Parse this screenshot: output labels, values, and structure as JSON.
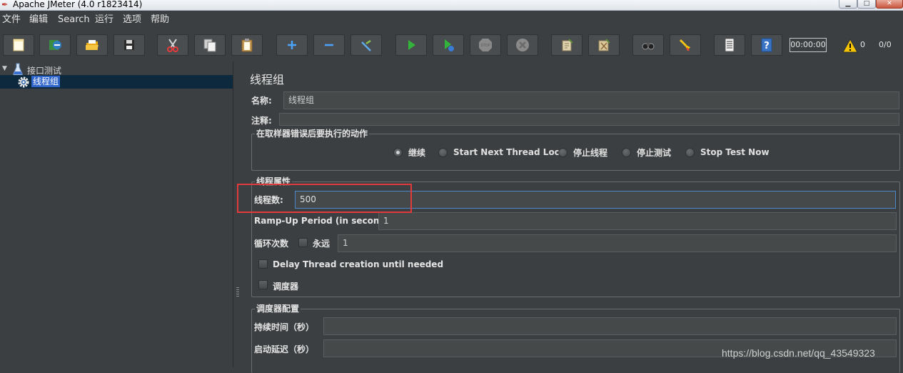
{
  "window": {
    "title": "Apache JMeter (4.0 r1823414)"
  },
  "menu": [
    "文件",
    "编辑",
    "Search",
    "运行",
    "选项",
    "帮助"
  ],
  "toolbar": {
    "buttons": [
      "new-icon",
      "templates-icon",
      "open-icon",
      "save-icon",
      "cut-icon",
      "copy-icon",
      "paste-icon",
      "expand-icon",
      "collapse-icon",
      "toggle-icon",
      "start-icon",
      "start-no-pause-icon",
      "stop-icon",
      "shutdown-icon",
      "clear-icon",
      "clear-all-icon",
      "search-icon",
      "reset-search-icon",
      "function-helper-icon",
      "help-icon"
    ],
    "timer": "00:00:00",
    "warnings": "0",
    "threads": "0/0"
  },
  "tree": {
    "root": "接口测试",
    "child": "线程组"
  },
  "panel": {
    "title": "线程组",
    "name_label": "名称:",
    "name_value": "线程组",
    "comment_label": "注释:",
    "comment_value": "",
    "error_group": "在取样器错误后要执行的动作",
    "error_options": [
      "继续",
      "Start Next Thread Loop",
      "停止线程",
      "停止测试",
      "Stop Test Now"
    ],
    "error_selected": "继续",
    "thread_group": "线程属性",
    "threads_label": "线程数:",
    "threads_value": "500",
    "rampup_label": "Ramp-Up Period (in seconds):",
    "rampup_value": "1",
    "loop_label": "循环次数",
    "forever_label": "永远",
    "loop_value": "1",
    "delay_label": "Delay Thread creation until needed",
    "scheduler_label": "调度器",
    "scheduler_group": "调度器配置",
    "duration_label": "持续时间（秒）",
    "duration_value": "",
    "startup_label": "启动延迟（秒）",
    "startup_value": ""
  },
  "watermark": "https://blog.csdn.net/qq_43549323"
}
